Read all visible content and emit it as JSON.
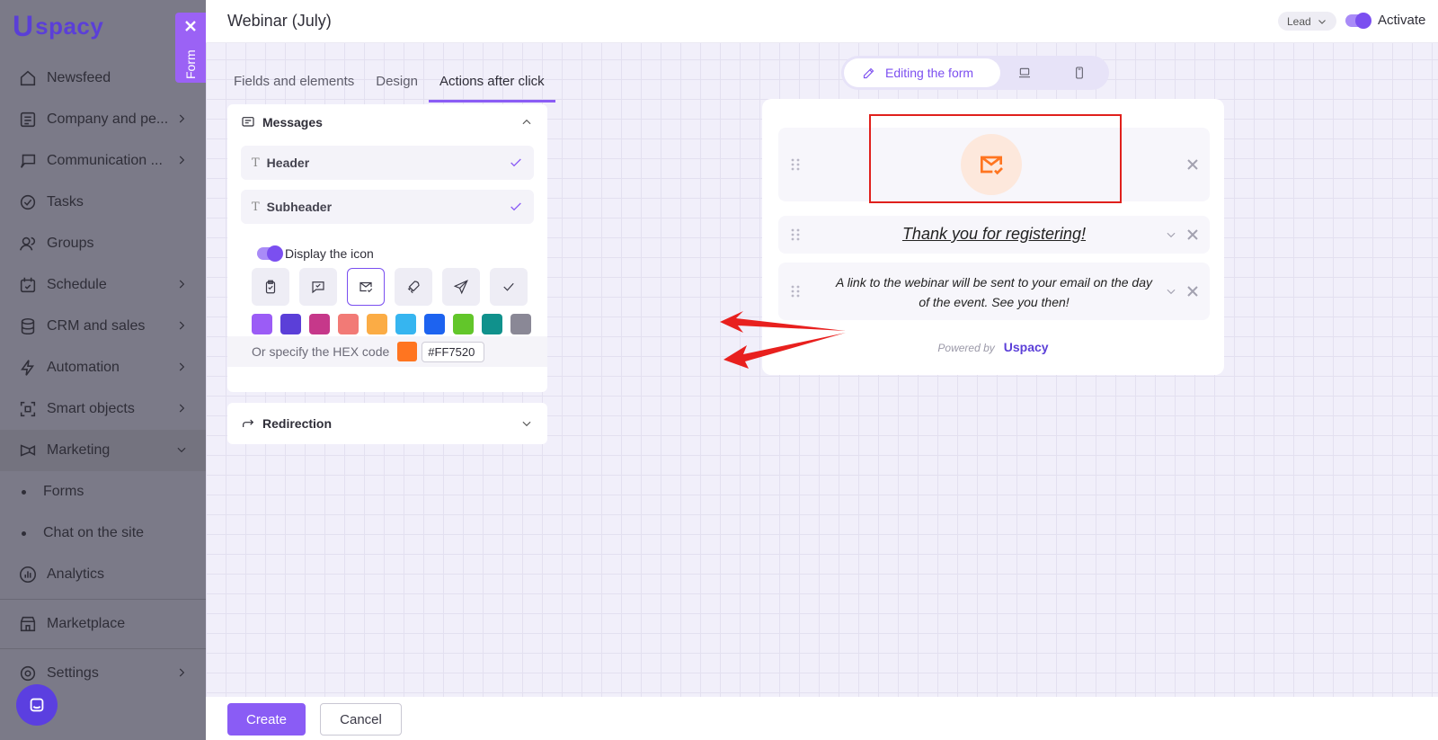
{
  "brand": {
    "logo_u": "U",
    "logo_text": "spacy"
  },
  "sidebar": {
    "items": [
      {
        "label": "Newsfeed",
        "icon": "home-icon",
        "chevron": false
      },
      {
        "label": "Company and pe...",
        "icon": "company-icon",
        "chevron": true
      },
      {
        "label": "Communication ...",
        "icon": "communication-icon",
        "chevron": true
      },
      {
        "label": "Tasks",
        "icon": "tasks-icon",
        "chevron": false
      },
      {
        "label": "Groups",
        "icon": "groups-icon",
        "chevron": false
      },
      {
        "label": "Schedule",
        "icon": "schedule-icon",
        "chevron": true
      },
      {
        "label": "CRM and sales",
        "icon": "crm-icon",
        "chevron": true
      },
      {
        "label": "Automation",
        "icon": "automation-icon",
        "chevron": true
      },
      {
        "label": "Smart objects",
        "icon": "smart-objects-icon",
        "chevron": true
      },
      {
        "label": "Marketing",
        "icon": "marketing-icon",
        "chevron": true,
        "expanded": true
      }
    ],
    "sub_items": [
      "Forms",
      "Chat on the site"
    ],
    "items_after": [
      {
        "label": "Analytics",
        "icon": "analytics-icon"
      },
      {
        "label": "Marketplace",
        "icon": "marketplace-icon"
      },
      {
        "label": "Settings",
        "icon": "settings-icon"
      }
    ]
  },
  "form_tab": {
    "label": "Form"
  },
  "header": {
    "title": "Webinar (July)",
    "entity_select": "Lead",
    "activate_label": "Activate",
    "activate_on": true
  },
  "tabs": [
    {
      "label": "Fields and elements",
      "active": false
    },
    {
      "label": "Design",
      "active": false
    },
    {
      "label": "Actions after click",
      "active": true
    }
  ],
  "messages_panel": {
    "title": "Messages",
    "fields": [
      {
        "label": "Header",
        "checked": true
      },
      {
        "label": "Subheader",
        "checked": true
      }
    ],
    "display_icon_label": "Display the icon",
    "display_icon_on": true,
    "icon_options": [
      "clipboard-check-icon",
      "message-check-icon",
      "mail-check-icon",
      "rocket-icon",
      "send-icon",
      "check-icon"
    ],
    "selected_icon": "mail-check-icon",
    "swatches": [
      "#9b5cf6",
      "#5b3fd8",
      "#c6388a",
      "#f27a76",
      "#fbac45",
      "#36b5f0",
      "#1d63f0",
      "#62c62a",
      "#10918c",
      "#8a8896"
    ],
    "hex_label": "Or specify the HEX code",
    "hex_value": "#FF7520"
  },
  "redirection_panel": {
    "title": "Redirection"
  },
  "preview": {
    "mode_label": "Editing the form",
    "header_text": "Thank you for registering!",
    "subheader_text": "A link to the webinar will be sent to your email on the day of the event. See you then!",
    "powered_by": "Powered by",
    "powered_brand": "Uspacy",
    "accent": "#FF7520"
  },
  "footer": {
    "create_label": "Create",
    "cancel_label": "Cancel"
  }
}
